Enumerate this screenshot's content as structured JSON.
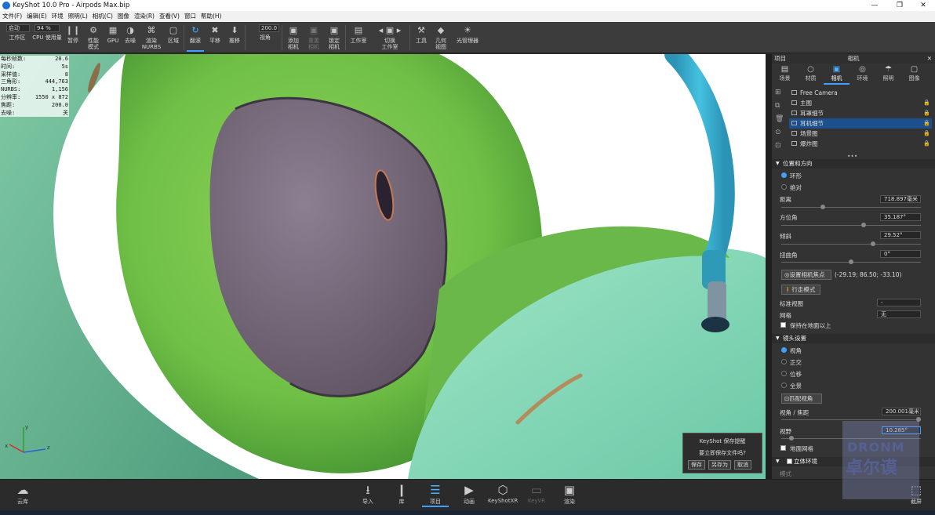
{
  "window": {
    "title": "KeyShot 10.0 Pro  - Airpods Max.bip",
    "minimize": "—",
    "maximize": "❐",
    "close": "✕"
  },
  "menu": [
    "文件(F)",
    "编辑(E)",
    "环境",
    "照明(L)",
    "相机(C)",
    "图像",
    "渲染(R)",
    "查看(V)",
    "窗口",
    "帮助(H)"
  ],
  "toolbar": {
    "workspace_select": "启动",
    "cpu_percent": "94 %",
    "fov_value": "200.0",
    "items": {
      "workspace": "工作区",
      "cpu": "CPU 使用量",
      "pause": "暂停",
      "perf": "性能\n模式",
      "gpu": "GPU",
      "denoise": "去噪",
      "nurbs": "渲染\nNURBS",
      "region": "区域",
      "tumble": "翻滚",
      "pan": "平移",
      "dolly": "推移",
      "view": "视角",
      "add_cam": "添加\n相机",
      "reset_cam": "重置\n相机",
      "lock_cam": "锁定\n相机",
      "studio": "工作室",
      "switch_studio": "切换\n工作室",
      "tools": "工具",
      "geo_view": "几何\n视图",
      "light_mgr": "光管理器"
    },
    "icons": {
      "workspace": "▣",
      "cpu": "",
      "pause": "❙❙",
      "perf": "⚙",
      "gpu": "▦",
      "denoise": "◑",
      "nurbs": "⌘",
      "region": "▢",
      "tumble": "↻",
      "pan": "✖",
      "dolly": "⬇",
      "view": "",
      "add_cam": "▣",
      "reset_cam": "▣",
      "lock_cam": "▣",
      "studio": "▤",
      "switch_studio": "◂ ▣ ▸",
      "tools": "⚒",
      "geo_view": "◆",
      "light_mgr": "☀"
    }
  },
  "stats": [
    [
      "每秒帧数:",
      "20.6"
    ],
    [
      "时间:",
      "5s"
    ],
    [
      "采样值:",
      "8"
    ],
    [
      "三角形:",
      "444,763"
    ],
    [
      "NURBS:",
      "1,156"
    ],
    [
      "分辨率:",
      "1550 x 872"
    ],
    [
      "焦距:",
      "200.0"
    ],
    [
      "去噪:",
      "关"
    ]
  ],
  "axes": {
    "y": "y",
    "z": "z",
    "x": "x"
  },
  "dialog": {
    "title": "KeyShot 保存提醒",
    "message": "要立即保存文件吗?",
    "save": "保存",
    "save_as": "另存为",
    "cancel": "取消"
  },
  "panel": {
    "header_left": "项目",
    "header_title": "相机",
    "close": "✕",
    "tabs": [
      {
        "label": "场景",
        "icon": "▤"
      },
      {
        "label": "材质",
        "icon": "○"
      },
      {
        "label": "相机",
        "icon": "▣"
      },
      {
        "label": "环境",
        "icon": "◎"
      },
      {
        "label": "照明",
        "icon": "☂"
      },
      {
        "label": "图像",
        "icon": "▢"
      }
    ],
    "cameras": [
      "Free Camera",
      "主图",
      "耳罩细节",
      "耳机细节",
      "场景图",
      "爆炸图"
    ],
    "more": "•••",
    "position_section": "位置和方向",
    "orbit": "环形",
    "absolute": "绝对",
    "distance_label": "距离",
    "distance_value": "718.897毫米",
    "azimuth_label": "方位角",
    "azimuth_value": "35.187°",
    "incline_label": "倾斜",
    "incline_value": "29.52°",
    "twist_label": "扭曲角",
    "twist_value": "0°",
    "set_focus": "设置相机焦点",
    "focus_coords": "(-29.19; 86.50; -33.10)",
    "walk_mode": "行走模式",
    "std_view_label": "标准视图",
    "std_view_value": "-",
    "grid_label": "网格",
    "grid_value": "无",
    "keep_above": "保持在地面以上",
    "lens_section": "镜头设置",
    "perspective": "视角",
    "orthographic": "正交",
    "shift": "位移",
    "panorama": "全景",
    "match_persp": "匹配视角",
    "focal_label": "视角 / 焦距",
    "focal_value": "200.001毫米",
    "fov_label": "视野",
    "fov_value": "10.285°",
    "ground_grid": "地面网格",
    "stereo_section": "立体环境",
    "mode_label": "模式"
  },
  "bottom": [
    {
      "label": "云库",
      "icon": "☁"
    },
    {
      "label": "导入",
      "icon": "⭳"
    },
    {
      "label": "库",
      "icon": "❙"
    },
    {
      "label": "项目",
      "icon": "☰"
    },
    {
      "label": "动画",
      "icon": "▶"
    },
    {
      "label": "KeyShotXR",
      "icon": "⬡"
    },
    {
      "label": "KeyVR",
      "icon": "▭"
    },
    {
      "label": "渲染",
      "icon": "▣"
    },
    {
      "label": "截屏",
      "icon": "⬚"
    }
  ],
  "watermark": {
    "line1": "DRONM",
    "line2": "卓尔谟"
  }
}
